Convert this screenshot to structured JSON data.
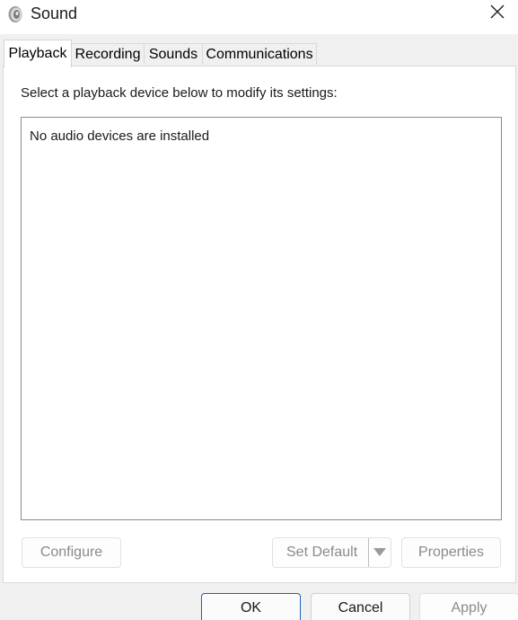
{
  "window": {
    "title": "Sound",
    "icon": "speaker-icon",
    "close_icon": "close-icon"
  },
  "tabs": [
    {
      "label": "Playback",
      "active": true
    },
    {
      "label": "Recording",
      "active": false
    },
    {
      "label": "Sounds",
      "active": false
    },
    {
      "label": "Communications",
      "active": false
    }
  ],
  "playback": {
    "instruction": "Select a playback device below to modify its settings:",
    "empty_message": "No audio devices are installed",
    "configure_label": "Configure",
    "set_default_label": "Set Default",
    "properties_label": "Properties"
  },
  "footer": {
    "ok_label": "OK",
    "cancel_label": "Cancel",
    "apply_label": "Apply"
  },
  "colors": {
    "default_button_border": "#1a60b8",
    "disabled_text": "#8a8a8a"
  }
}
